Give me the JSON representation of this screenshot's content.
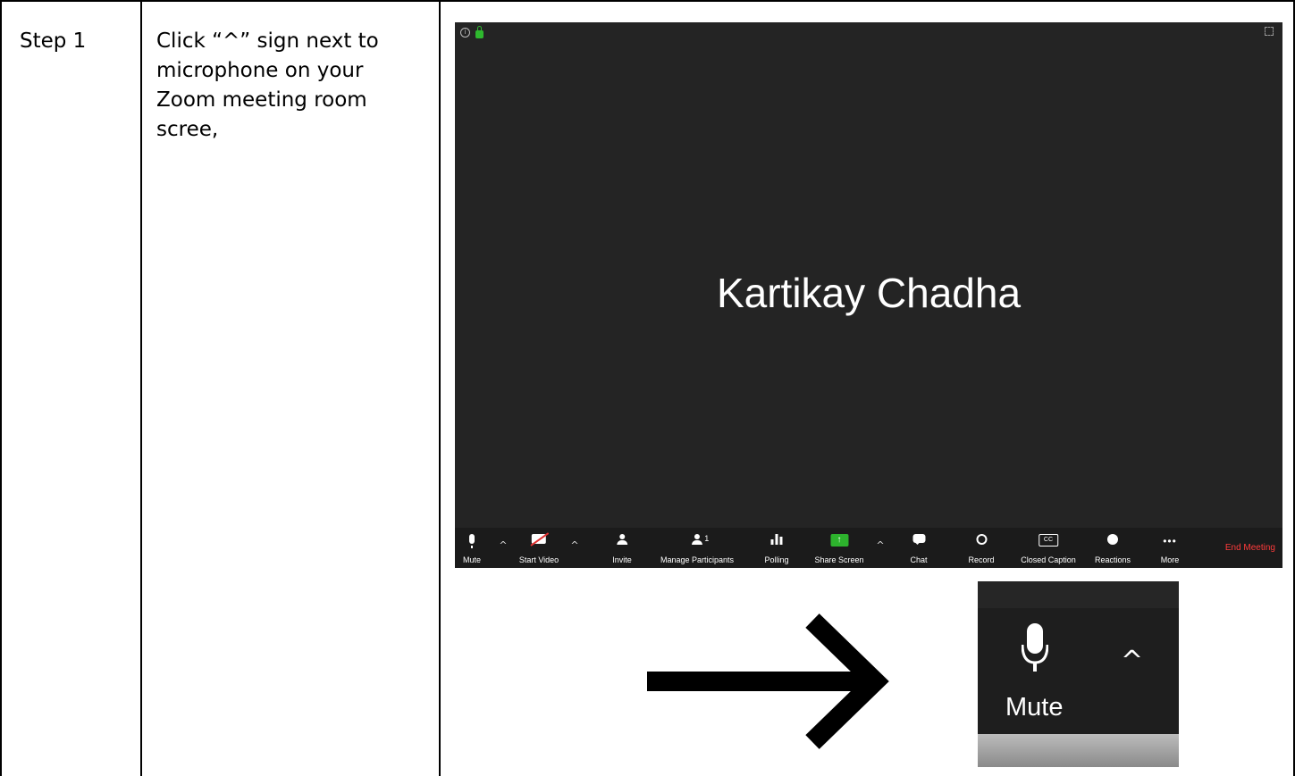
{
  "table": {
    "step_label": "Step 1",
    "instruction": "Click “^” sign next to\nmicrophone on your\nZoom meeting room\nscree,"
  },
  "zoom_window": {
    "participant_name": "Kartikay Chadha",
    "toolbar": {
      "mute": "Mute",
      "start_video": "Start Video",
      "invite": "Invite",
      "manage_participants": "Manage Participants",
      "participant_count": "1",
      "polling": "Polling",
      "share_screen": "Share Screen",
      "chat": "Chat",
      "record": "Record",
      "closed_caption": "Closed Caption",
      "closed_caption_icon": "CC",
      "reactions": "Reactions",
      "more": "More",
      "end_meeting": "End Meeting"
    },
    "end_meeting_color": "#ff3b3b",
    "share_color": "#2db32d"
  },
  "zoomed_crop": {
    "label": "Mute",
    "caret": "^"
  }
}
